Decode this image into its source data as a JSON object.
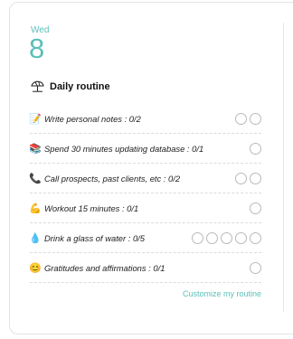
{
  "header": {
    "day": "Wed",
    "date": "8"
  },
  "routine": {
    "title": "Daily routine",
    "items": [
      {
        "emoji": "📝",
        "emoji_name": "memo-icon",
        "label": "Write personal notes : 0/2",
        "circles": 2
      },
      {
        "emoji": "📚",
        "emoji_name": "books-icon",
        "label": "Spend 30 minutes updating database : 0/1",
        "circles": 1
      },
      {
        "emoji": "📞",
        "emoji_name": "phone-icon",
        "label": "Call prospects, past clients, etc : 0/2",
        "circles": 2
      },
      {
        "emoji": "💪",
        "emoji_name": "muscle-icon",
        "label": "Workout 15 minutes : 0/1",
        "circles": 1
      },
      {
        "emoji": "💧",
        "emoji_name": "droplet-icon",
        "label": "Drink a glass of water : 0/5",
        "circles": 5
      },
      {
        "emoji": "😊",
        "emoji_name": "smile-icon",
        "label": "Gratitudes and affirmations : 0/1",
        "circles": 1
      }
    ],
    "customize_label": "Customize my routine"
  },
  "colors": {
    "accent": "#5bbfba",
    "circle_border": "#b9b9b9"
  }
}
